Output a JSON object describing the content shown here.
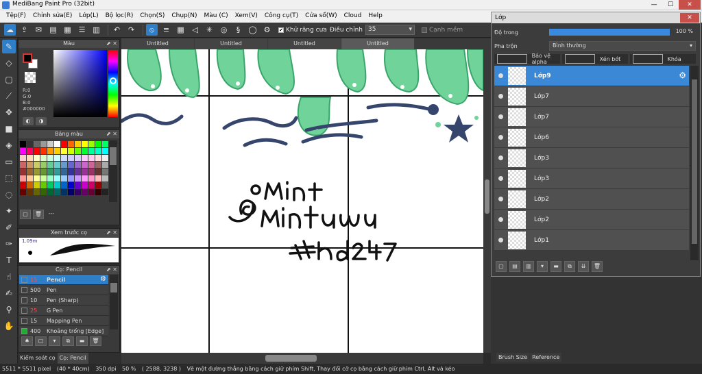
{
  "window": {
    "title": "MediBang Paint Pro (32bit)"
  },
  "menu": [
    "Tệp(F)",
    "Chỉnh sửa(E)",
    "Lớp(L)",
    "Bộ lọc(R)",
    "Chọn(S)",
    "Chụp(N)",
    "Màu (C)",
    "Xem(V)",
    "Công cụ(T)",
    "Cửa sổ(W)",
    "Cloud",
    "Help"
  ],
  "toolbar": {
    "antialias_label": "Khử răng cưa",
    "adjust_label": "Điều chỉnh",
    "adjust_value": "35",
    "edge_label": "Cạnh mềm"
  },
  "panels": {
    "color": {
      "title": "Màu",
      "r": "R:0",
      "g": "G:0",
      "b": "B:0",
      "hex": "#000000"
    },
    "palette": {
      "title": "Bảng màu",
      "footer_text": "---"
    },
    "preview": {
      "title": "Xem trước cọ",
      "size": "1.09m"
    },
    "brush": {
      "title": "Cọ: Pencil",
      "items": [
        {
          "size": "15",
          "name": "Pencil",
          "color": "#333333",
          "red": true
        },
        {
          "size": "500",
          "name": "Pen",
          "color": "#333333",
          "red": false
        },
        {
          "size": "10",
          "name": "Pen (Sharp)",
          "color": "#333333",
          "red": false
        },
        {
          "size": "25",
          "name": "G Pen",
          "color": "#333333",
          "red": true
        },
        {
          "size": "15",
          "name": "Mapping Pen",
          "color": "#333333",
          "red": false
        },
        {
          "size": "400",
          "name": "Khoảng trống [Edge]",
          "color": "#22aa33",
          "red": false
        }
      ]
    }
  },
  "bottom_tabs": [
    "Kiểm soát cọ",
    "Cọ: Pencil"
  ],
  "canvas": {
    "tabs": [
      "Untitled",
      "Untitled",
      "Untitled",
      "Untitled"
    ],
    "active_tab": 3
  },
  "layer_window": {
    "title": "Lớp",
    "opacity_label": "Độ trong",
    "opacity_value": "100 %",
    "opacity_fraction": 1.0,
    "blend_label": "Pha trộn",
    "blend_value": "Bình thường",
    "opt_protect": "Bảo vệ alpha",
    "opt_clip": "Xén bớt",
    "opt_lock": "Khóa",
    "layers": [
      "Lớp9",
      "Lớp7",
      "Lớp7",
      "Lớp6",
      "Lớp3",
      "Lớp3",
      "Lớp2",
      "Lớp2",
      "Lớp1"
    ],
    "active_layer": 0
  },
  "right_tabs": [
    "Brush Size",
    "Reference"
  ],
  "status": {
    "size": "5511 * 5511 pixel",
    "cm": "(40 * 40cm)",
    "dpi": "350 dpi",
    "zoom": "50 %",
    "coords": "( 2588, 3238 )",
    "hint": "Vẽ một đường thẳng bằng cách giữ phím Shift, Thay đổi cỡ cọ bằng cách giữ phím Ctrl, Alt và kéo"
  },
  "colors": {
    "accent": "#2f7fc8",
    "mint": "#6fd39a",
    "navy": "#35456b"
  }
}
